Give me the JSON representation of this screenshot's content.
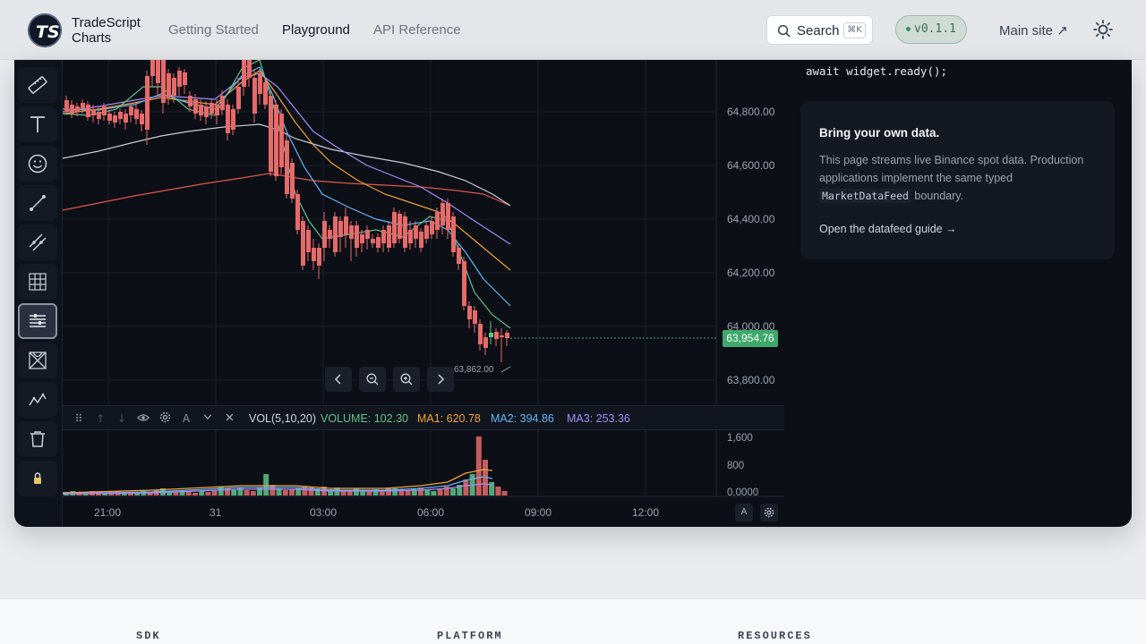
{
  "header": {
    "brand_line1": "TradeScript",
    "brand_line2": "Charts",
    "nav": [
      {
        "label": "Getting Started",
        "active": false
      },
      {
        "label": "Playground",
        "active": true
      },
      {
        "label": "API Reference",
        "active": false
      }
    ],
    "search_label": "Search",
    "search_shortcut": "⌘K",
    "version": "v0.1.1",
    "main_site": "Main site ↗"
  },
  "toolbar": {
    "icons": [
      "ruler-icon",
      "text-icon",
      "emoji-icon",
      "trend-line-icon",
      "parallel-line-icon",
      "grid-icon",
      "indicator-settings-icon",
      "pattern-icon",
      "wave-icon",
      "trash-icon",
      "lock-icon"
    ],
    "active_index": 6
  },
  "chart": {
    "price_axis": [
      "64,800.00",
      "64,600.00",
      "64,400.00",
      "64,200.00",
      "64,000.00",
      "63,800.00"
    ],
    "current_price": "63,954.76",
    "low_label": "63,862.00",
    "volume_axis": [
      "1,600",
      "800",
      "0.0000"
    ],
    "time_axis": [
      "21:00",
      "31",
      "03:00",
      "06:00",
      "09:00",
      "12:00"
    ],
    "corner_auto": "A"
  },
  "volume_toolbar": {
    "name": "VOL(5,10,20)",
    "volume": "VOLUME: 102.30",
    "ma1": "MA1: 620.78",
    "ma2": "MA2: 394.86",
    "ma3": "MA3: 253.36",
    "font_btn": "A",
    "colors": {
      "volume": "#5fc38a",
      "ma1": "#f2a33a",
      "ma2": "#64b5f6",
      "ma3": "#a78bfa"
    }
  },
  "info": {
    "code": "await widget.ready();",
    "card_title": "Bring your own data.",
    "card_body_1": "This page streams live Binance spot data. Production applications implement the same typed",
    "card_body_code": "MarketDataFeed",
    "card_body_2": "boundary.",
    "card_link": "Open the datafeed guide →"
  },
  "footer": {
    "columns": [
      "SDK",
      "PLATFORM",
      "RESOURCES"
    ]
  }
}
